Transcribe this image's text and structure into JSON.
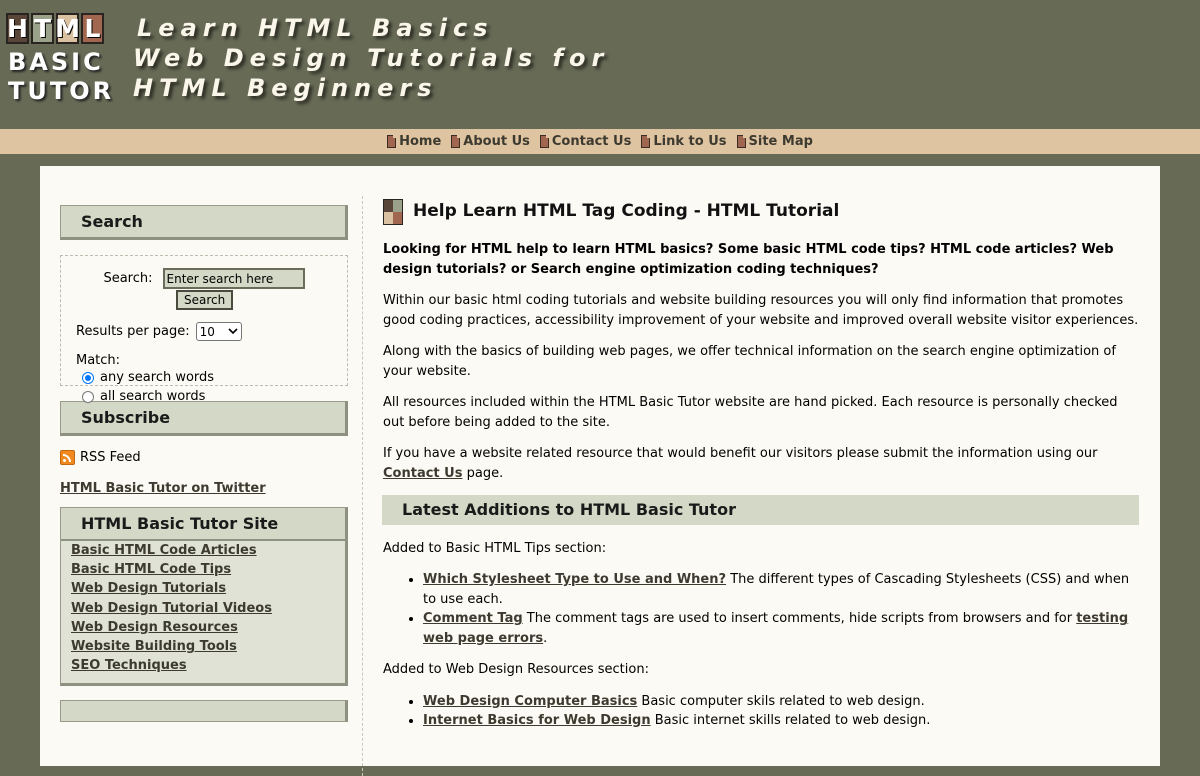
{
  "logo": {
    "tiles": [
      "H",
      "T",
      "M",
      "L"
    ],
    "word1": "BASIC",
    "word2": "TUTOR",
    "tile_colors": [
      "#5a4638",
      "#9aa38a",
      "#d9c1a2",
      "#a06650"
    ]
  },
  "tagline": {
    "line1": "Learn HTML Basics",
    "line2": "Web Design Tutorials for",
    "line3": "HTML Beginners"
  },
  "nav": {
    "items": [
      "Home",
      "About Us",
      "Contact Us",
      "Link to Us",
      "Site Map"
    ]
  },
  "sidebar": {
    "search": {
      "title": "Search",
      "label": "Search:",
      "value": "Enter search here",
      "button": "Search",
      "results_label": "Results per page:",
      "results_value": "10",
      "match_label": "Match:",
      "options": [
        "any search words",
        "all search words"
      ],
      "selected": "any search words"
    },
    "subscribe": {
      "title": "Subscribe",
      "rss": "RSS Feed",
      "twitter": "HTML Basic Tutor on Twitter"
    },
    "site": {
      "title": "HTML Basic Tutor Site",
      "links": [
        "Basic HTML Code Articles",
        "Basic HTML Code Tips",
        "Web Design Tutorials",
        "Web Design Tutorial Videos",
        "Web Design Resources",
        "Website Building Tools",
        "SEO Techniques"
      ]
    }
  },
  "main": {
    "title": "Help Learn HTML Tag Coding - HTML Tutorial",
    "intro": "Looking for HTML help to learn HTML basics? Some basic HTML code tips? HTML code articles? Web design tutorials? or Search engine optimization coding techniques?",
    "p1": "Within our basic html coding tutorials and website building resources you will only find information that promotes good coding practices, accessibility improvement of your website and improved overall website visitor experiences.",
    "p2": "Along with the basics of building web pages, we offer technical information on the search engine optimization of your website.",
    "p3": "All resources included within the HTML Basic Tutor website are hand picked. Each resource is personally checked out before being added to the site.",
    "p4_before": "If you have a website related resource that would benefit our visitors please submit the information using our ",
    "p4_link": "Contact Us",
    "p4_after": " page.",
    "latest_title": "Latest Additions to HTML Basic Tutor",
    "tips_intro": "Added to Basic HTML Tips section:",
    "tips": {
      "item1_link": "Which Stylesheet Type to Use and When?",
      "item1_text": " The different types of Cascading Stylesheets (CSS) and when to use each.",
      "item2_link": "Comment Tag",
      "item2_text": " The comment tags are used to insert comments, hide scripts from browsers and for ",
      "item2_link2": "testing web page errors",
      "item2_end": "."
    },
    "resources_intro": "Added to Web Design Resources section:",
    "resources": {
      "item1_link": "Web Design Computer Basics",
      "item1_text": " Basic computer skils related to web design.",
      "item2_link": "Internet Basics for Web Design",
      "item2_text": " Basic internet skills related to web design."
    }
  }
}
